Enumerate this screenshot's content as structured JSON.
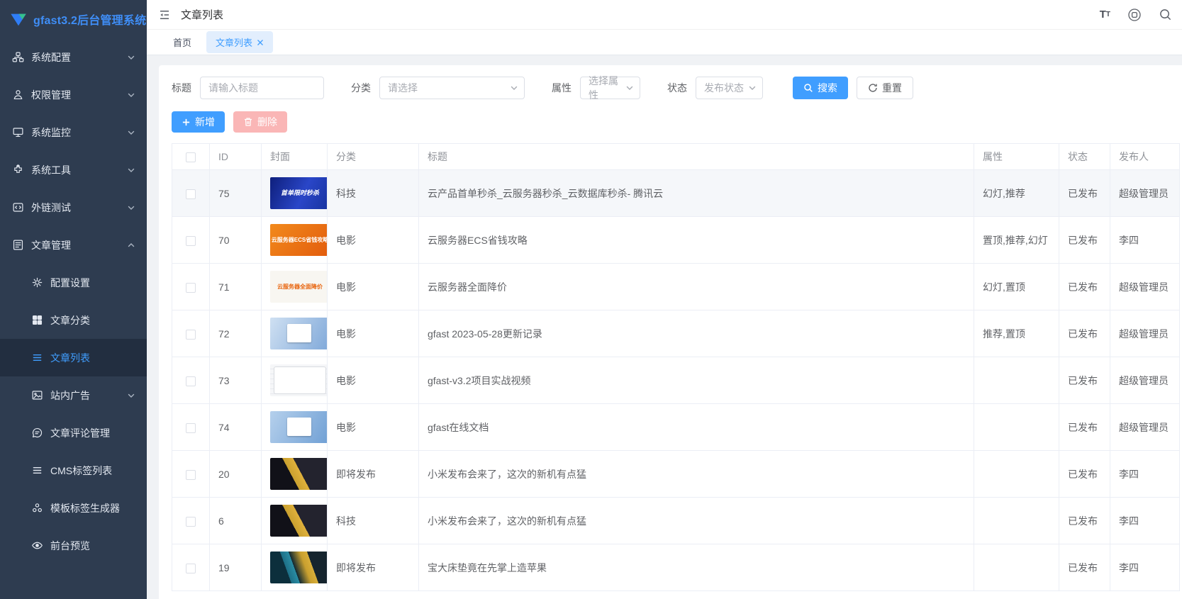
{
  "app": {
    "title": "gfast3.2后台管理系统"
  },
  "topbar": {
    "page_title": "文章列表"
  },
  "tabs": [
    {
      "label": "首页",
      "active": false
    },
    {
      "label": "文章列表",
      "active": true
    }
  ],
  "sidebar": {
    "items": [
      {
        "label": "系统配置",
        "icon": "org-icon",
        "chevron": "down"
      },
      {
        "label": "权限管理",
        "icon": "user-icon",
        "chevron": "down"
      },
      {
        "label": "系统监控",
        "icon": "monitor-icon",
        "chevron": "down"
      },
      {
        "label": "系统工具",
        "icon": "tools-icon",
        "chevron": "down"
      },
      {
        "label": "外链测试",
        "icon": "link-icon",
        "chevron": "down"
      },
      {
        "label": "文章管理",
        "icon": "article-icon",
        "chevron": "up"
      },
      {
        "label": "配置设置",
        "icon": "gear-icon",
        "sub": true
      },
      {
        "label": "文章分类",
        "icon": "grid-icon",
        "sub": true
      },
      {
        "label": "文章列表",
        "icon": "list-icon",
        "sub": true,
        "active": true
      },
      {
        "label": "站内广告",
        "icon": "ad-icon",
        "sub": true,
        "chevron": "down"
      },
      {
        "label": "文章评论管理",
        "icon": "comment-icon",
        "sub": true
      },
      {
        "label": "CMS标签列表",
        "icon": "list-icon",
        "sub": true
      },
      {
        "label": "模板标签生成器",
        "icon": "shapes-icon",
        "sub": true
      },
      {
        "label": "前台预览",
        "icon": "eye-icon",
        "sub": true
      }
    ]
  },
  "filters": {
    "title_label": "标题",
    "title_placeholder": "请输入标题",
    "category_label": "分类",
    "category_placeholder": "请选择",
    "attribute_label": "属性",
    "attribute_placeholder": "选择属性",
    "status_label": "状态",
    "status_placeholder": "发布状态",
    "search_label": "搜索",
    "reset_label": "重置"
  },
  "toolbar": {
    "add_label": "新增",
    "delete_label": "删除"
  },
  "table": {
    "columns": [
      "ID",
      "封面",
      "分类",
      "标题",
      "属性",
      "状态",
      "发布人"
    ],
    "rows": [
      {
        "id": "75",
        "cover": "promo-blue",
        "cover_label": "首单限时秒杀",
        "category": "科技",
        "title": "云产品首单秒杀_云服务器秒杀_云数据库秒杀- 腾讯云",
        "attrs": "幻灯,推荐",
        "status": "已发布",
        "publisher": "超级管理员",
        "highlight": true
      },
      {
        "id": "70",
        "cover": "promo-orange",
        "cover_label": "云服务器ECS省钱攻略",
        "category": "电影",
        "title": "云服务器ECS省钱攻略",
        "attrs": "置顶,推荐,幻灯",
        "status": "已发布",
        "publisher": "李四"
      },
      {
        "id": "71",
        "cover": "promo-white",
        "cover_label": "云服务器全面降价",
        "category": "电影",
        "title": "云服务器全面降价",
        "attrs": "幻灯,置顶",
        "status": "已发布",
        "publisher": "超级管理员"
      },
      {
        "id": "72",
        "cover": "shot-blue",
        "cover_label": "",
        "category": "电影",
        "title": "gfast 2023-05-28更新记录",
        "attrs": "推荐,置顶",
        "status": "已发布",
        "publisher": "超级管理员"
      },
      {
        "id": "73",
        "cover": "shot-white",
        "cover_label": "",
        "category": "电影",
        "title": "gfast-v3.2项目实战视频",
        "attrs": "",
        "status": "已发布",
        "publisher": "超级管理员"
      },
      {
        "id": "74",
        "cover": "doc-blue",
        "cover_label": "",
        "category": "电影",
        "title": "gfast在线文档",
        "attrs": "",
        "status": "已发布",
        "publisher": "超级管理员"
      },
      {
        "id": "20",
        "cover": "photo-dark",
        "cover_label": "",
        "category": "即将发布",
        "title": "小米发布会来了，这次的新机有点猛",
        "attrs": "",
        "status": "已发布",
        "publisher": "李四"
      },
      {
        "id": "6",
        "cover": "photo-dark",
        "cover_label": "",
        "category": "科技",
        "title": "小米发布会来了，这次的新机有点猛",
        "attrs": "",
        "status": "已发布",
        "publisher": "李四"
      },
      {
        "id": "19",
        "cover": "photo-teal",
        "cover_label": "",
        "category": "即将发布",
        "title": "宝大床垫竟在先掌上造苹果",
        "attrs": "",
        "status": "已发布",
        "publisher": "李四"
      }
    ]
  }
}
